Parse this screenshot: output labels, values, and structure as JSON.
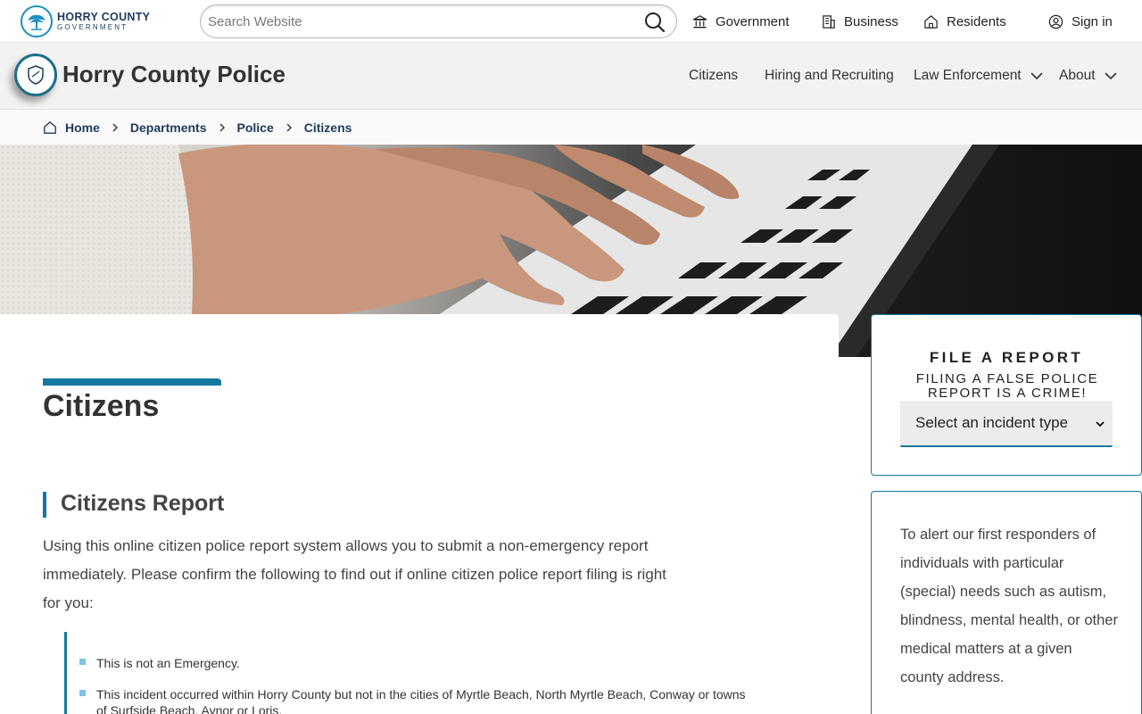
{
  "header": {
    "logo_line1": "HORRY COUNTY",
    "logo_line2": "GOVERNMENT",
    "search_placeholder": "Search Website",
    "nav": [
      {
        "label": "Government",
        "icon": "government-building-icon"
      },
      {
        "label": "Business",
        "icon": "business-building-icon"
      },
      {
        "label": "Residents",
        "icon": "home-icon"
      }
    ],
    "sign_in": "Sign in"
  },
  "department": {
    "title": "Horry County Police",
    "nav": [
      {
        "label": "Citizens",
        "has_dropdown": false
      },
      {
        "label": "Hiring and Recruiting",
        "has_dropdown": false
      },
      {
        "label": "Law Enforcement",
        "has_dropdown": true
      },
      {
        "label": "About",
        "has_dropdown": true
      }
    ]
  },
  "breadcrumb": [
    "Home",
    "Departments",
    "Police",
    "Citizens"
  ],
  "main": {
    "page_title": "Citizens",
    "section_title": "Citizens Report",
    "intro": "Using this online citizen police report system allows you to submit a non-emergency report immediately. Please confirm the following to find out if online citizen police report filing is right for you:",
    "list": [
      "This is not an Emergency.",
      "This incident occurred within Horry County but not in the cities of Myrtle Beach, North Myrtle Beach, Conway or towns of Surfside Beach, Aynor or Loris."
    ]
  },
  "sidebar": {
    "file_report_title": "FILE A REPORT",
    "file_report_warning": "FILING A FALSE POLICE REPORT IS A CRIME!",
    "select_value": "Select an incident type",
    "alert_text": "To alert our first responders of individuals with particular (special) needs such as autism, blindness, mental health, or other medical matters at a given county address."
  },
  "colors": {
    "accent": "#1479a0",
    "navy": "#1d3b5a",
    "bullet": "#7cc4e4"
  }
}
